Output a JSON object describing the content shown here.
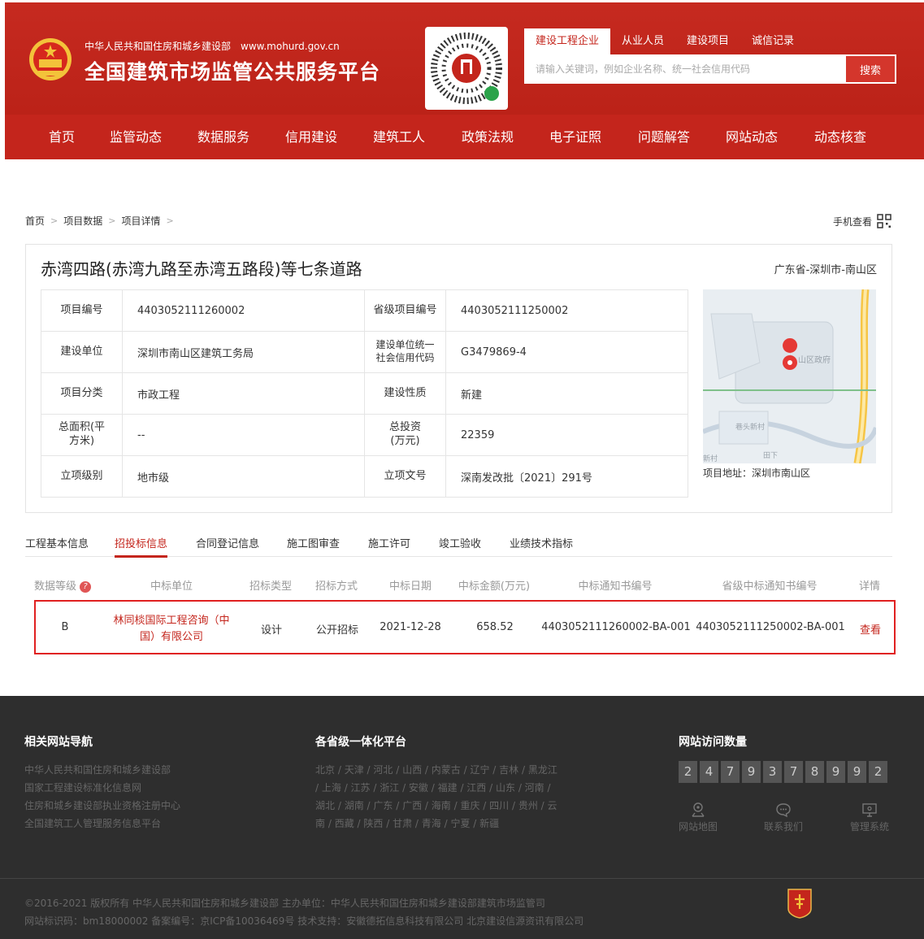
{
  "header": {
    "site_subtitle": "中华人民共和国住房和城乡建设部",
    "site_url": "www.mohurd.gov.cn",
    "site_title": "全国建筑市场监管公共服务平台",
    "search_tabs": [
      "建设工程企业",
      "从业人员",
      "建设项目",
      "诚信记录"
    ],
    "search_placeholder": "请输入关键词，例如企业名称、统一社会信用代码",
    "search_button": "搜索",
    "nav": [
      "首页",
      "监管动态",
      "数据服务",
      "信用建设",
      "建筑工人",
      "政策法规",
      "电子证照",
      "问题解答",
      "网站动态",
      "动态核查"
    ],
    "brand_color": "#c4251c"
  },
  "breadcrumb": [
    "首页",
    "项目数据",
    "项目详情"
  ],
  "mobile_view": "手机查看",
  "project": {
    "title": "赤湾四路(赤湾九路至赤湾五路段)等七条道路",
    "region": "广东省-深圳市-南山区",
    "rows": [
      {
        "l1": "项目编号",
        "v1": "4403052111260002",
        "l2": "省级项目编号",
        "v2": "4403052111250002"
      },
      {
        "l1": "建设单位",
        "v1": "深圳市南山区建筑工务局",
        "l2": "建设单位统一社会信用代码",
        "v2": "G3479869-4"
      },
      {
        "l1": "项目分类",
        "v1": "市政工程",
        "l2": "建设性质",
        "v2": "新建"
      },
      {
        "l1": "总面积(平方米)",
        "v1": "--",
        "l2": "总投资(万元)",
        "v2": "22359"
      },
      {
        "l1": "立项级别",
        "v1": "地市级",
        "l2": "立项文号",
        "v2": "深南发改批〔2021〕291号"
      }
    ],
    "map_labels": [
      "山区政府",
      "巷头新村",
      "田下",
      "新村"
    ],
    "address": "项目地址：深圳市南山区"
  },
  "tabs": [
    "工程基本信息",
    "招投标信息",
    "合同登记信息",
    "施工图审查",
    "施工许可",
    "竣工验收",
    "业绩技术指标"
  ],
  "bid_table": {
    "headers": [
      "数据等级",
      "中标单位",
      "招标类型",
      "招标方式",
      "中标日期",
      "中标金额(万元)",
      "中标通知书编号",
      "省级中标通知书编号",
      "详情"
    ],
    "help_mark": "?",
    "row": {
      "grade": "B",
      "unit": "林同棪国际工程咨询（中国）有限公司",
      "type": "设计",
      "method": "公开招标",
      "date": "2021-12-28",
      "amount": "658.52",
      "notice_no": "4403052111260002-BA-001",
      "prov_notice_no": "4403052111250002-BA-001",
      "detail": "查看"
    }
  },
  "footer": {
    "links_title": "相关网站导航",
    "links": [
      "中华人民共和国住房和城乡建设部",
      "国家工程建设标准化信息网",
      "住房和城乡建设部执业资格注册中心",
      "全国建筑工人管理服务信息平台"
    ],
    "provinces_title": "各省级一体化平台",
    "provinces": [
      "北京",
      "天津",
      "河北",
      "山西",
      "内蒙古",
      "辽宁",
      "吉林",
      "黑龙江",
      "上海",
      "江苏",
      "浙江",
      "安徽",
      "福建",
      "江西",
      "山东",
      "河南",
      "湖北",
      "湖南",
      "广东",
      "广西",
      "海南",
      "重庆",
      "四川",
      "贵州",
      "云南",
      "西藏",
      "陕西",
      "甘肃",
      "青海",
      "宁夏",
      "新疆"
    ],
    "visits_title": "网站访问数量",
    "visit_digits": [
      "2",
      "4",
      "7",
      "9",
      "3",
      "7",
      "8",
      "9",
      "9",
      "2"
    ],
    "icons": [
      "网站地图",
      "联系我们",
      "管理系统"
    ],
    "copyright_line1": "©2016-2021 版权所有 中华人民共和国住房和城乡建设部   主办单位：中华人民共和国住房和城乡建设部建筑市场监管司",
    "copyright_line2": "网站标识码：bm18000002   备案编号：京ICP备10036469号   技术支持：安徽德拓信息科技有限公司 北京建设信源资讯有限公司"
  }
}
